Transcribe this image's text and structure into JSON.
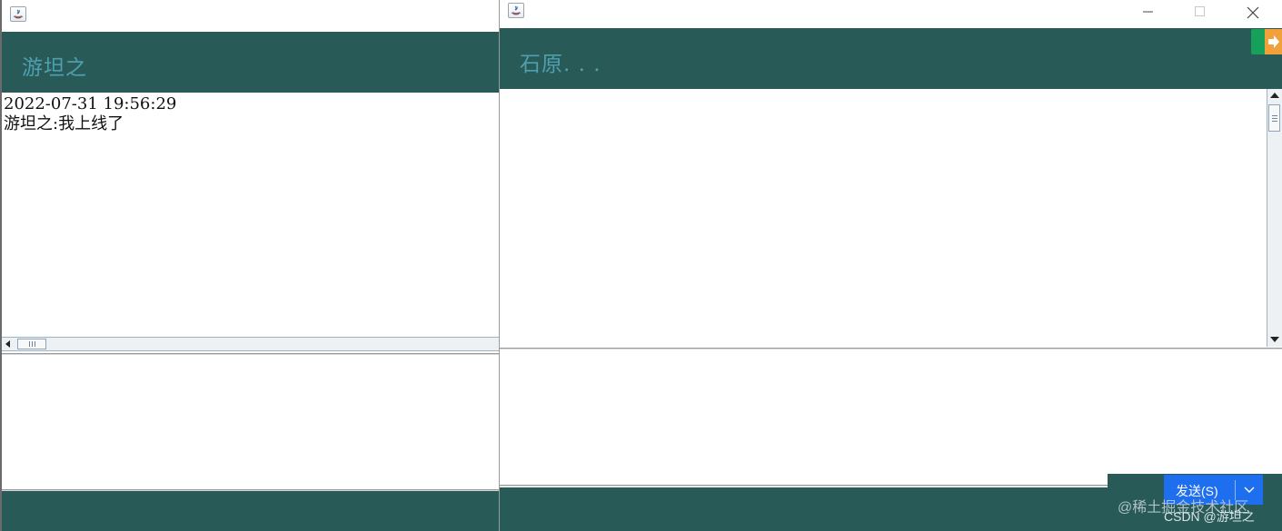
{
  "left_window": {
    "header_name": "游坦之",
    "chat_lines": [
      "2022-07-31 19:56:29",
      "游坦之:我上线了"
    ],
    "input_value": ""
  },
  "right_window": {
    "header_name": "石原. . .",
    "chat_lines": [],
    "input_value": "",
    "send_label": "发送(S)"
  },
  "watermarks": {
    "line1": "@稀土掘金技术社区",
    "line2": "CSDN @游坦之"
  },
  "colors": {
    "header_band": "#285a58",
    "header_text": "#4f9fae",
    "send_button": "#1e6ff0"
  },
  "icons": [
    "java-app-icon",
    "minimize-icon",
    "maximize-icon",
    "close-icon",
    "scroll-arrow-icon",
    "chevron-down-icon"
  ]
}
